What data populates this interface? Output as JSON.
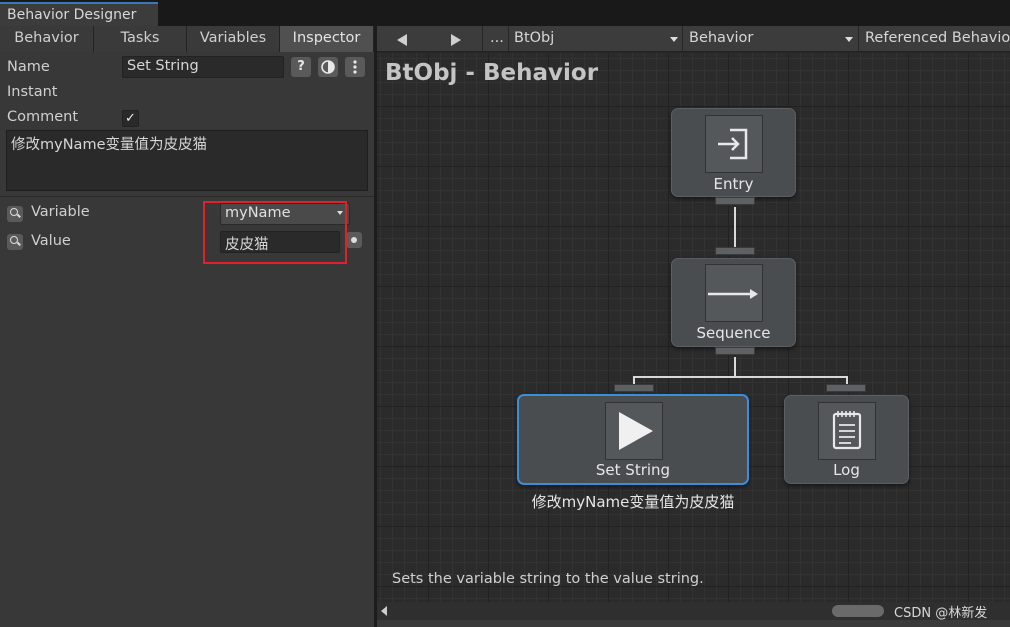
{
  "window": {
    "title": "Behavior Designer"
  },
  "panel": {
    "tabs": [
      "Behavior",
      "Tasks",
      "Variables",
      "Inspector"
    ],
    "active_tab": "Inspector",
    "name_label": "Name",
    "name_value": "Set String",
    "help_icon_text": "?",
    "instant_label": "Instant",
    "instant_checked": "✓",
    "comment_label": "Comment",
    "comment_value": "修改myName变量值为皮皮猫",
    "variable_label": "Variable",
    "variable_value": "myName",
    "value_label": "Value",
    "value_value": "皮皮猫"
  },
  "toolbar": {
    "ellipsis": "...",
    "object": "BtObj",
    "behavior": "Behavior",
    "referenced": "Referenced Behavio"
  },
  "graph": {
    "title": "BtObj - Behavior",
    "nodes": {
      "entry": "Entry",
      "sequence": "Sequence",
      "set_string": "Set String",
      "log": "Log"
    },
    "set_string_comment": "修改myName变量值为皮皮猫",
    "task_description": "Sets the variable string to the value string."
  },
  "watermark": "CSDN @林新发",
  "colors": {
    "selection": "#3c8ed8",
    "highlight_box": "#e0202a",
    "title_tab_accent": "#3a79bb"
  }
}
